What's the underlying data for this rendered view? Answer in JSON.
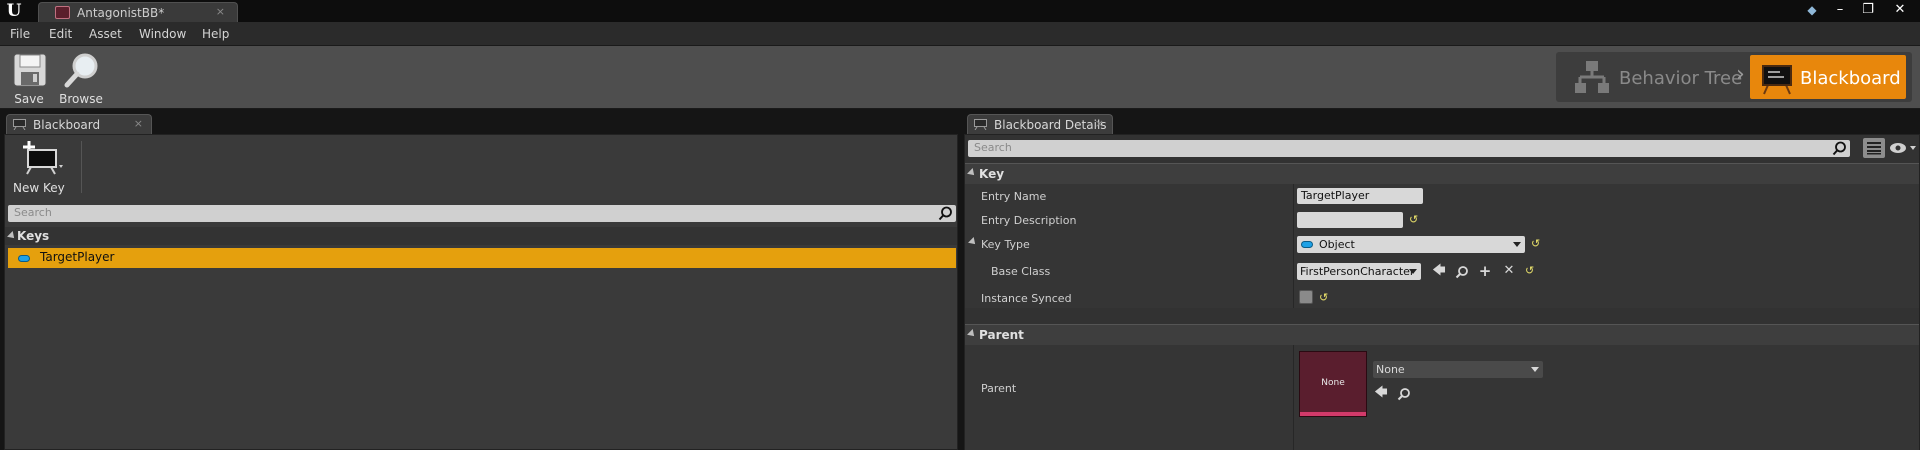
{
  "window": {
    "tab_title": "AntagonistBB*",
    "tab_close": "×",
    "controls": {
      "minimize": "–",
      "maximize": "❐",
      "close": "✕"
    }
  },
  "menu": [
    "File",
    "Edit",
    "Asset",
    "Window",
    "Help"
  ],
  "toolbar": {
    "save_label": "Save",
    "browse_label": "Browse",
    "mode_behavior_tree": "Behavior Tree",
    "mode_separator": "›",
    "mode_blackboard": "Blackboard"
  },
  "left_panel": {
    "tab_label": "Blackboard",
    "tab_close": "×",
    "new_key_label": "New Key",
    "search_placeholder": "Search",
    "keys_header": "Keys",
    "keys": [
      {
        "name": "TargetPlayer",
        "type_color": "#1ea1e6",
        "selected": true
      }
    ]
  },
  "right_panel": {
    "tab_label": "Blackboard Details",
    "tab_close": "×",
    "search_placeholder": "Search",
    "key_section": {
      "title": "Key",
      "entry_name_label": "Entry Name",
      "entry_name_value": "TargetPlayer",
      "entry_description_label": "Entry Description",
      "entry_description_value": "",
      "key_type_label": "Key Type",
      "key_type_value": "Object",
      "base_class_label": "Base Class",
      "base_class_value": "FirstPersonCharacter",
      "instance_synced_label": "Instance Synced",
      "instance_synced": false
    },
    "parent_section": {
      "title": "Parent",
      "parent_label": "Parent",
      "thumbnail_text": "None",
      "parent_value": "None"
    }
  },
  "colors": {
    "accent": "#e8870c",
    "selection": "#e5a00d",
    "object_key": "#1ea1e6",
    "reset_arrow": "#e8e06a"
  }
}
